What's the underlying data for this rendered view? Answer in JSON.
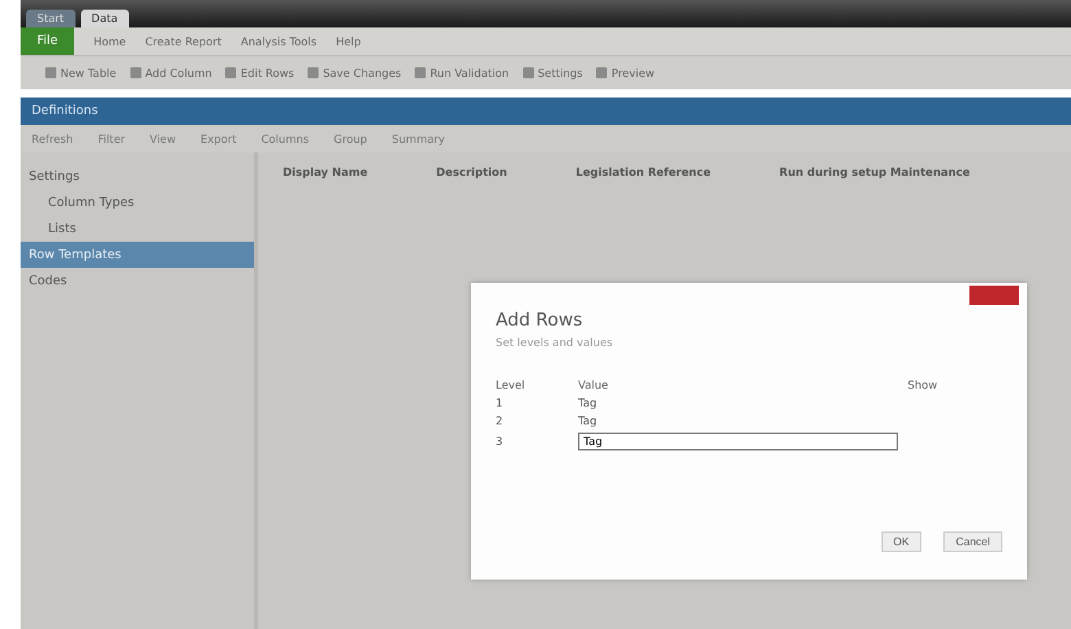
{
  "window": {
    "tabs": [
      {
        "label": "Start",
        "selected": false
      },
      {
        "label": "Data",
        "selected": true
      }
    ]
  },
  "menu": {
    "app_button": "File",
    "items": [
      "Home",
      "Create Report",
      "Analysis Tools",
      "Help"
    ]
  },
  "toolbar": [
    "New Table",
    "Add Column",
    "Edit Rows",
    "Save Changes",
    "Run Validation",
    "Settings",
    "Preview"
  ],
  "banner": "Definitions",
  "subtoolbar": [
    "Refresh",
    "Filter",
    "View",
    "Export",
    "Columns",
    "Group",
    "Summary"
  ],
  "sidebar": {
    "items": [
      {
        "label": "Settings",
        "selected": false,
        "children": [
          {
            "label": "Column Types",
            "selected": false
          },
          {
            "label": "Lists",
            "selected": false
          }
        ]
      },
      {
        "label": "Row Templates",
        "selected": true
      },
      {
        "label": "Codes",
        "selected": false
      }
    ]
  },
  "table": {
    "columns": [
      "Display Name",
      "Description",
      "Legislation Reference",
      "Run during setup Maintenance"
    ]
  },
  "dialog": {
    "title": "Add Rows",
    "subtitle": "Set levels and values",
    "columns": [
      "Level",
      "Value",
      "Show"
    ],
    "rows": [
      {
        "level": "1",
        "value": "Tag",
        "editing": false
      },
      {
        "level": "2",
        "value": "Tag",
        "editing": false
      },
      {
        "level": "3",
        "value": "Tag",
        "editing": true
      }
    ],
    "buttons": [
      "OK",
      "Cancel"
    ]
  }
}
